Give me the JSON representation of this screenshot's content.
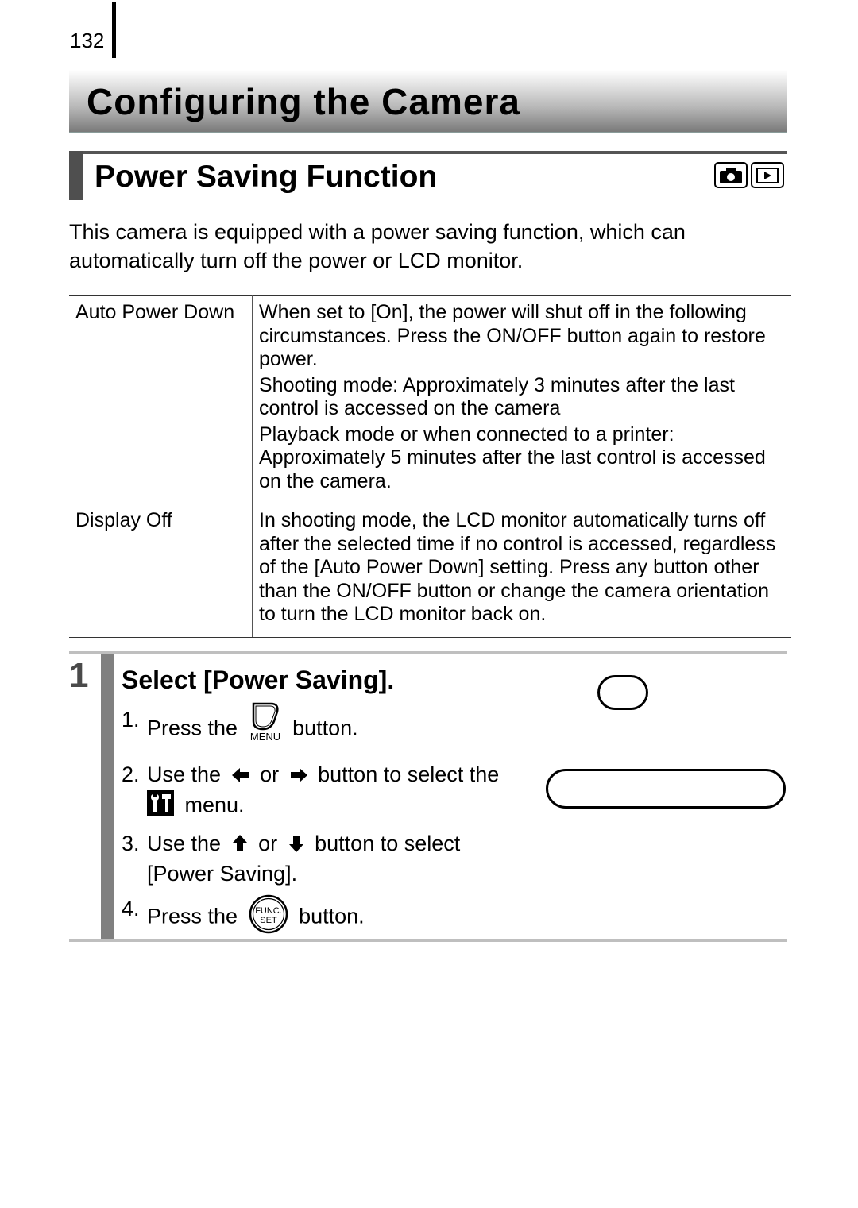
{
  "page": {
    "number": "132"
  },
  "chapter": {
    "title": "Configuring the Camera"
  },
  "section": {
    "title": "Power Saving Function",
    "mode_icons": [
      "camera-shooting-mode-icon",
      "playback-mode-icon"
    ]
  },
  "intro": {
    "text": "This camera is equipped with a power saving function, which can automatically turn off the power or LCD monitor."
  },
  "settings_table": {
    "rows": [
      {
        "name": "Auto Power Down",
        "paragraphs": [
          "When set to [On], the power will shut off in the following circumstances. Press the ON/OFF button again to restore power.",
          "Shooting mode: Approximately 3 minutes after the last control is accessed on the camera",
          "Playback mode or when connected to a printer: Approximately 5 minutes after the last control is accessed on the camera."
        ]
      },
      {
        "name": "Display Off",
        "paragraphs": [
          "In shooting mode, the LCD monitor automatically turns off after the selected time if no control is accessed, regardless of the [Auto Power Down] setting. Press any button other than the ON/OFF button or change the camera orientation to turn the LCD monitor back on."
        ]
      }
    ]
  },
  "step": {
    "number": "1",
    "title": "Select [Power Saving].",
    "items": [
      {
        "num": "1.",
        "before": "Press the",
        "icon": "menu-button-icon",
        "icon_label": "MENU",
        "after": "button."
      },
      {
        "num": "2.",
        "before": "Use the",
        "icon_a": "left-arrow-icon",
        "mid": "or",
        "icon_b": "right-arrow-icon",
        "after": "button to select the",
        "icon_c": "setup-menu-icon",
        "tail": "menu."
      },
      {
        "num": "3.",
        "before": "Use the",
        "icon_a": "up-arrow-icon",
        "mid": "or",
        "icon_b": "down-arrow-icon",
        "after": "button to select",
        "tail": "[Power Saving]."
      },
      {
        "num": "4.",
        "before": "Press the",
        "icon": "func-set-button-icon",
        "icon_label_top": "FUNC.",
        "icon_label_bottom": "SET",
        "after": "button."
      }
    ]
  }
}
